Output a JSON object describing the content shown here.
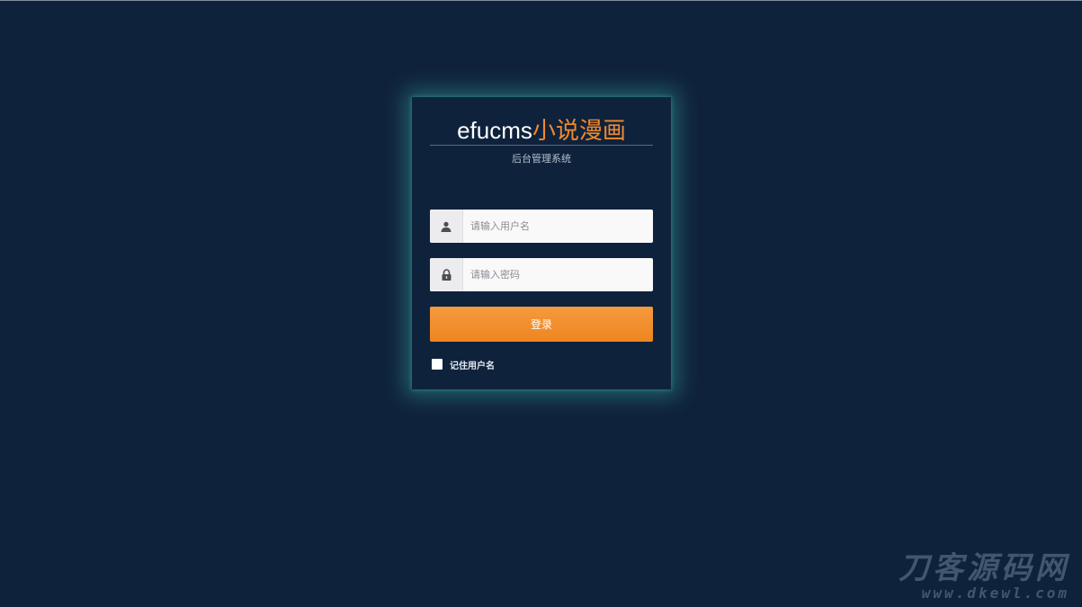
{
  "login": {
    "brand_en": "efucms",
    "brand_cn": "小说漫画",
    "subtitle": "后台管理系统",
    "username_placeholder": "请输入用户名",
    "username_value": "",
    "password_placeholder": "请输入密码",
    "password_value": "",
    "submit_label": "登录",
    "remember_label": "记住用户名",
    "remember_checked": false
  },
  "icons": {
    "username": "user-icon",
    "password": "lock-icon"
  },
  "colors": {
    "background": "#0f223c",
    "accent": "#f0892c",
    "glow": "#40c4b4"
  },
  "watermark": {
    "text_cn": "刀客源码网",
    "url": "www.dkewl.com"
  }
}
